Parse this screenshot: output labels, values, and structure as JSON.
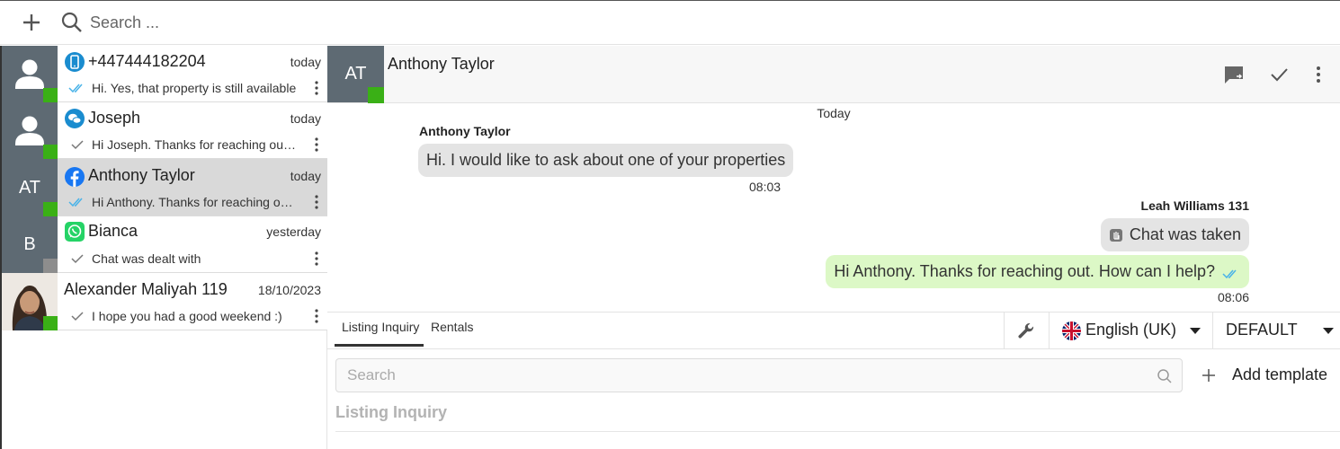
{
  "topbar": {
    "search_placeholder": "Search ...",
    "add_icon": "plus-icon",
    "search_icon": "search-icon"
  },
  "chats": [
    {
      "avatar": "person",
      "channel": "phone-icon",
      "name": "+447444182204",
      "date": "today",
      "preview": "Hi. Yes, that property is still available",
      "status": "double-check-blue",
      "online": true
    },
    {
      "avatar": "person",
      "channel": "chat-bubbles-icon",
      "name": "Joseph",
      "date": "today",
      "preview": "Hi Joseph. Thanks for reaching out. How can I help?",
      "status": "check-grey",
      "online": true
    },
    {
      "avatar": "AT",
      "channel": "facebook-icon",
      "name": "Anthony Taylor",
      "date": "today",
      "preview": "Hi Anthony. Thanks for reaching out. How can I help?",
      "status": "double-check-blue",
      "online": true,
      "active": true
    },
    {
      "avatar": "B",
      "channel": "whatsapp-icon",
      "name": "Bianca",
      "date": "yesterday",
      "preview": "Chat was dealt with",
      "status": "check-grey",
      "online": false
    },
    {
      "avatar": "photo",
      "channel": "",
      "name": "Alexander Maliyah 119",
      "date": "18/10/2023",
      "preview": "I hope you had a good weekend :)",
      "status": "check-grey",
      "online": true
    }
  ],
  "header": {
    "avatar": "AT",
    "name": "Anthony Taylor",
    "icons": [
      "transfer-chat-icon",
      "check-icon",
      "more-vertical-icon"
    ]
  },
  "messages": {
    "day": "Today",
    "items": [
      {
        "direction": "in",
        "sender": "Anthony Taylor",
        "text": "Hi. I would like to ask about one of your properties",
        "time": "08:03"
      },
      {
        "direction": "sys",
        "sender": "Leah Williams 131",
        "text": "Chat was taken"
      },
      {
        "direction": "out",
        "text": "Hi Anthony. Thanks for reaching out. How can I help?",
        "time": "08:06"
      }
    ]
  },
  "composer": {
    "tabs": [
      "Listing Inquiry",
      "Rentals"
    ],
    "active_tab": 0,
    "language": "English (UK)",
    "template_set": "DEFAULT",
    "search_placeholder": "Search",
    "add_template": "Add template",
    "section_title": "Listing Inquiry"
  },
  "colors": {
    "online": "#3ab016",
    "offline": "#8d8d8d",
    "avatar_bg": "#5e6a73",
    "outgoing_bubble": "#dcf8c6",
    "incoming_bubble": "#e4e4e4",
    "read_tick": "#4ab3e8"
  }
}
